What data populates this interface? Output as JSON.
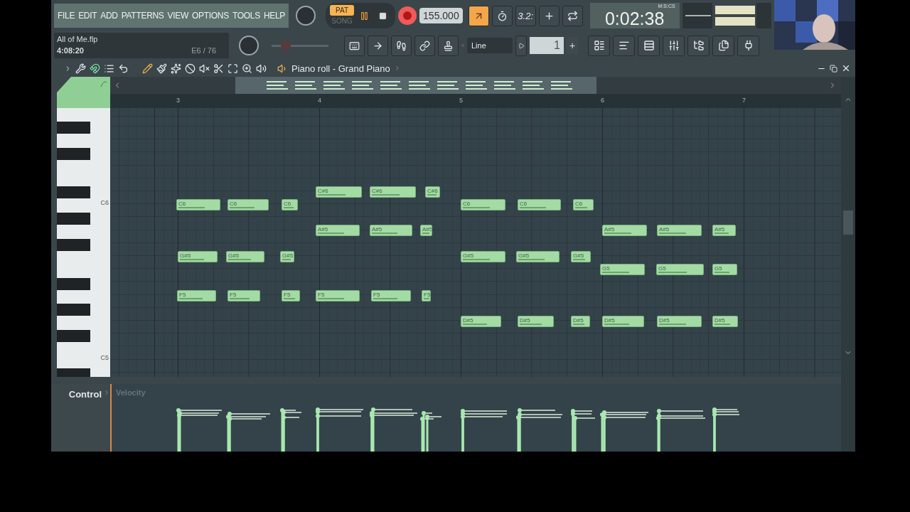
{
  "menu": [
    "FILE",
    "EDIT",
    "ADD",
    "PATTERNS",
    "VIEW",
    "OPTIONS",
    "TOOLS",
    "HELP"
  ],
  "transport": {
    "modes": [
      {
        "label": "PAT",
        "selected": true
      },
      {
        "label": "SONG",
        "selected": false
      }
    ],
    "tempo": "155.000",
    "time": "0:02:38",
    "time_format": "M:S:CS"
  },
  "top_tools": [
    {
      "on": true
    },
    {
      "on": false
    },
    {
      "label": "3.2:"
    },
    {
      "on": false
    },
    {
      "on": false
    }
  ],
  "project": {
    "file": "All of Me.flp",
    "length": "4:08:20",
    "note_info": "E6 / 76"
  },
  "pitch_slider": {
    "level": 0.25
  },
  "snap": {
    "value": "Line"
  },
  "pattern": {
    "value": "1",
    "add": "+"
  },
  "piano_tools": [
    {
      "on": false
    },
    {
      "on": true
    },
    {
      "on": false
    },
    {
      "on": false
    },
    {
      "on": true
    },
    {
      "on": false
    },
    {
      "on": false
    },
    {
      "on": false
    },
    {
      "on": false
    },
    {
      "on": false
    },
    {
      "on": false
    },
    {
      "on": false
    },
    {
      "on": false
    }
  ],
  "piano_roll": {
    "title": "Piano roll - Grand Piano",
    "bars": [
      "3",
      "4",
      "5",
      "6",
      "7"
    ],
    "key_labels": [
      "C6",
      "C5"
    ],
    "notes": [
      {
        "label": "C#6"
      },
      {
        "label": "C#6"
      },
      {
        "label": "C#6"
      },
      {
        "label": "C6"
      },
      {
        "label": "C6"
      },
      {
        "label": "C6"
      },
      {
        "label": "C6"
      },
      {
        "label": "C6"
      },
      {
        "label": "C6"
      },
      {
        "label": "A#5"
      },
      {
        "label": "A#5"
      },
      {
        "label": "A#5"
      },
      {
        "label": "A#5"
      },
      {
        "label": "A#5"
      },
      {
        "label": "A#5"
      },
      {
        "label": "G#5"
      },
      {
        "label": "G#5"
      },
      {
        "label": "G#5"
      },
      {
        "label": "G#5"
      },
      {
        "label": "G#5"
      },
      {
        "label": "G#5"
      },
      {
        "label": "G5"
      },
      {
        "label": "G5"
      },
      {
        "label": "G5"
      },
      {
        "label": "F5"
      },
      {
        "label": "F5"
      },
      {
        "label": "F5"
      },
      {
        "label": "F5"
      },
      {
        "label": "F5"
      },
      {
        "label": "F5"
      },
      {
        "label": "D#5"
      },
      {
        "label": "D#5"
      },
      {
        "label": "D#5"
      },
      {
        "label": "D#5"
      },
      {
        "label": "D#5"
      },
      {
        "label": "D#5"
      }
    ],
    "control": {
      "label": "Control",
      "target": "Velocity"
    }
  }
}
